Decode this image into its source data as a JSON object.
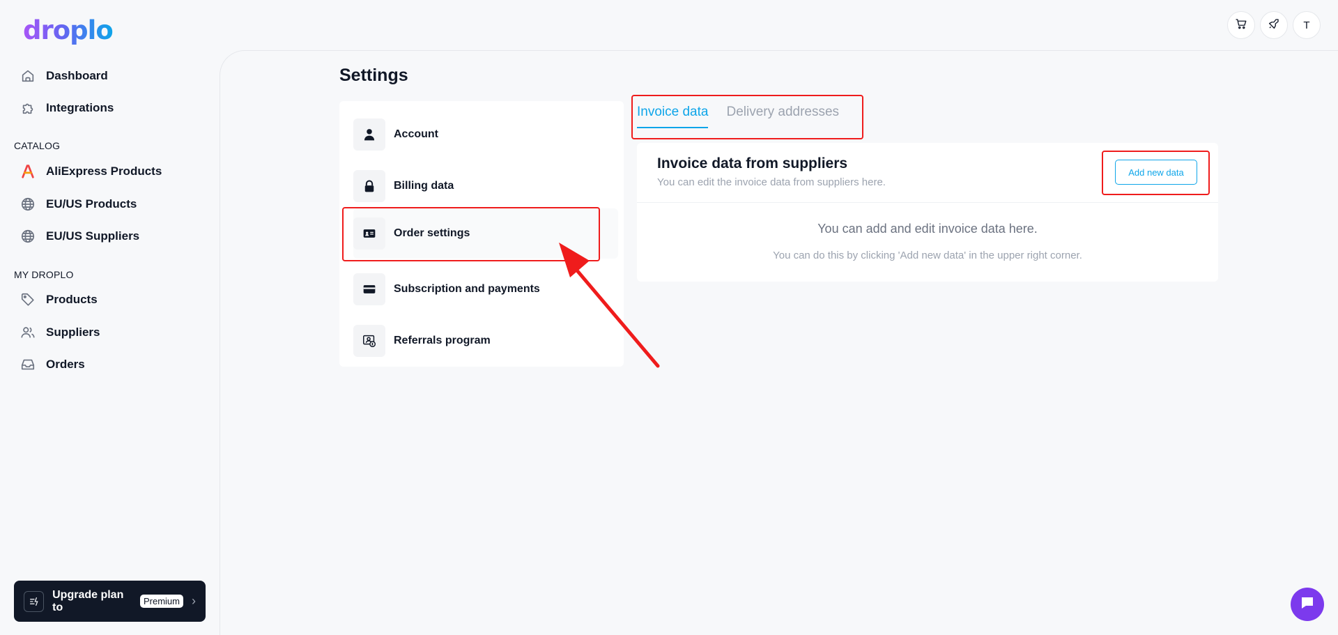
{
  "brand": {
    "logo_text": "droplo"
  },
  "sidebar": {
    "top_items": [
      {
        "label": "Dashboard",
        "icon": "home-icon"
      },
      {
        "label": "Integrations",
        "icon": "puzzle-icon"
      }
    ],
    "catalog_label": "CATALOG",
    "catalog_items": [
      {
        "label": "AliExpress Products",
        "icon": "aliexpress-icon"
      },
      {
        "label": "EU/US Products",
        "icon": "globe-icon"
      },
      {
        "label": "EU/US Suppliers",
        "icon": "globe-icon"
      }
    ],
    "my_label": "MY DROPLO",
    "my_items": [
      {
        "label": "Products",
        "icon": "tag-icon"
      },
      {
        "label": "Suppliers",
        "icon": "users-icon"
      },
      {
        "label": "Orders",
        "icon": "inbox-icon"
      }
    ],
    "upgrade": {
      "text": "Upgrade plan to",
      "badge": "Premium"
    }
  },
  "topbar": {
    "avatar_initial": "T"
  },
  "page": {
    "title": "Settings"
  },
  "settings_menu": [
    {
      "label": "Account",
      "icon": "user-icon"
    },
    {
      "label": "Billing data",
      "icon": "lock-icon"
    },
    {
      "label": "Order settings",
      "icon": "id-card-icon"
    },
    {
      "label": "Subscription and payments",
      "icon": "credit-card-icon"
    },
    {
      "label": "Referrals program",
      "icon": "referral-icon"
    }
  ],
  "tabs": [
    {
      "label": "Invoice data",
      "active": true
    },
    {
      "label": "Delivery addresses",
      "active": false
    }
  ],
  "invoice_card": {
    "title": "Invoice data from suppliers",
    "subtitle": "You can edit the invoice data from suppliers here.",
    "add_button": "Add new data",
    "empty_title": "You can add and edit invoice data here.",
    "empty_subtitle": "You can do this by clicking 'Add new data' in the upper right corner."
  },
  "colors": {
    "accent": "#0ea5e9",
    "annotation": "#ef1c1c",
    "chat": "#7c3aed",
    "dark": "#111827"
  }
}
